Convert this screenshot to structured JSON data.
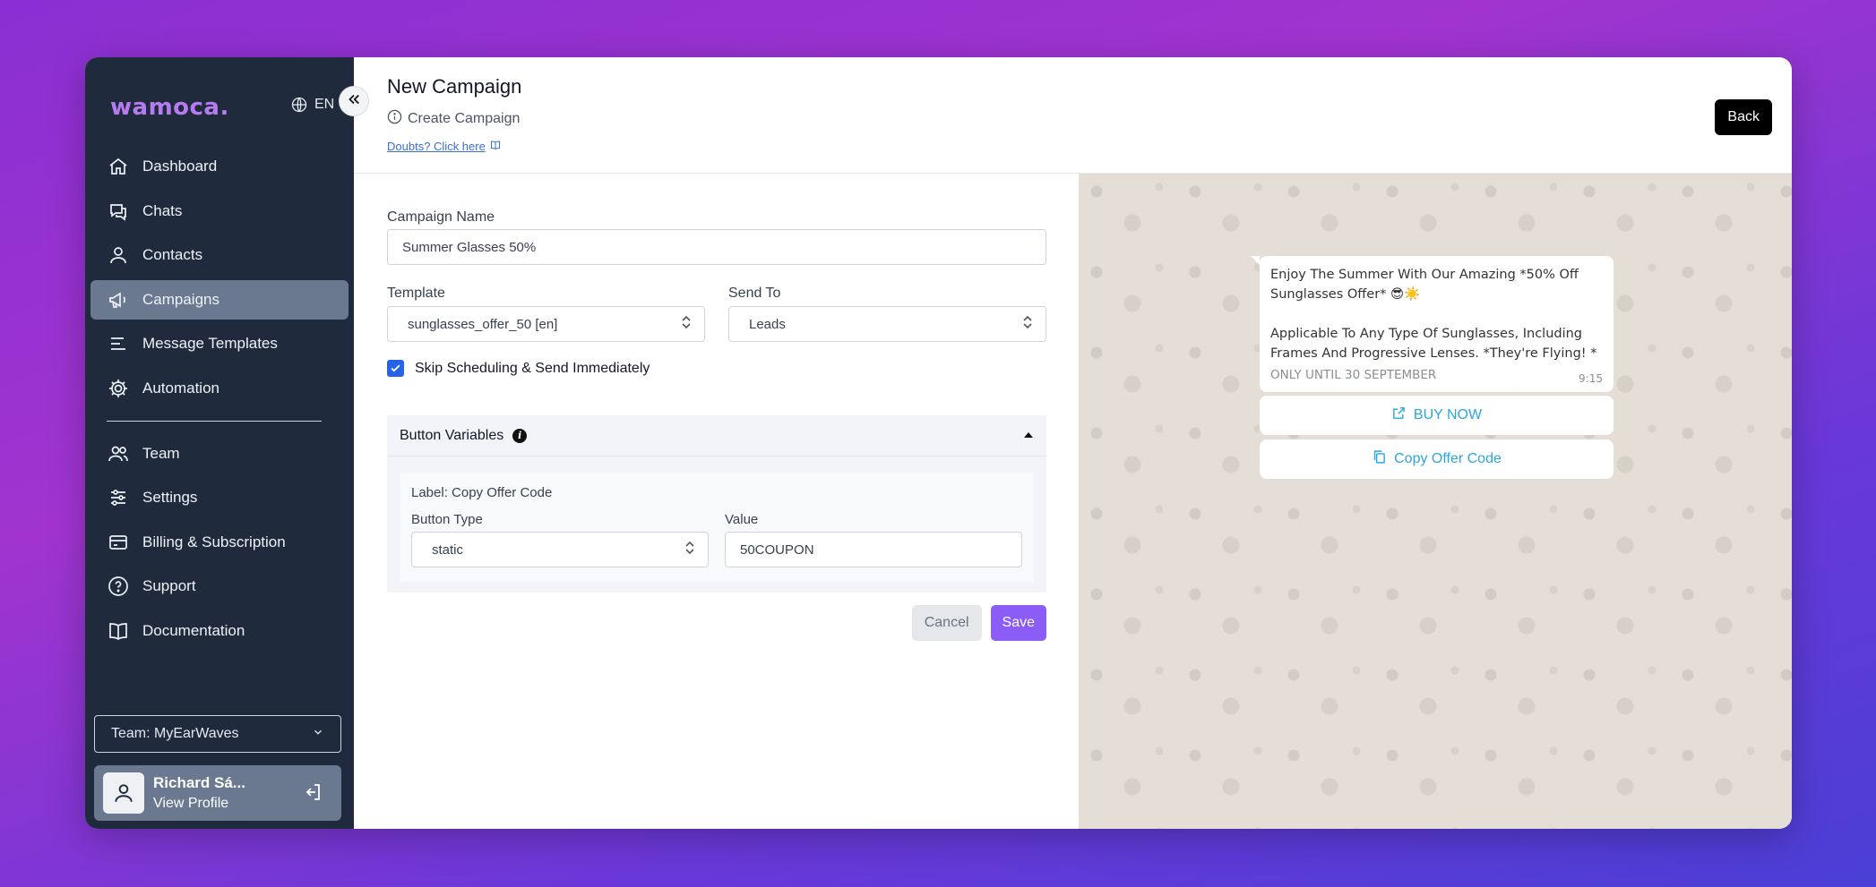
{
  "sidebar": {
    "logo": "wamoca.",
    "language": "EN",
    "items": [
      {
        "label": "Dashboard"
      },
      {
        "label": "Chats"
      },
      {
        "label": "Contacts"
      },
      {
        "label": "Campaigns"
      },
      {
        "label": "Message Templates"
      },
      {
        "label": "Automation"
      },
      {
        "label": "Team"
      },
      {
        "label": "Settings"
      },
      {
        "label": "Billing & Subscription"
      },
      {
        "label": "Support"
      },
      {
        "label": "Documentation"
      }
    ],
    "active_item": "Campaigns",
    "team_select": "Team: MyEarWaves",
    "profile": {
      "name": "Richard Sá...",
      "link": "View Profile"
    }
  },
  "header": {
    "title": "New Campaign",
    "subtitle": "Create Campaign",
    "doubts_link": "Doubts? Click here",
    "back_label": "Back"
  },
  "form": {
    "campaign_name_label": "Campaign Name",
    "campaign_name_value": "Summer Glasses 50%",
    "template_label": "Template",
    "template_value": "sunglasses_offer_50 [en]",
    "send_to_label": "Send To",
    "send_to_value": "Leads",
    "skip_label": "Skip Scheduling & Send Immediately",
    "skip_checked": true,
    "button_variables": {
      "title": "Button Variables",
      "item_label": "Label: Copy Offer Code",
      "button_type_label": "Button Type",
      "button_type_value": "static",
      "value_label": "Value",
      "value_value": "50COUPON"
    },
    "cancel_label": "Cancel",
    "save_label": "Save"
  },
  "preview": {
    "message": "Enjoy The Summer With Our Amazing *50% Off Sunglasses Offer* 😎☀️\n\nApplicable To Any Type Of Sunglasses, Including Frames And Progressive Lenses. *They're Flying! *",
    "footer": "ONLY UNTIL 30 SEPTEMBER",
    "time": "9:15",
    "buttons": [
      {
        "label": "BUY NOW",
        "icon": "external-link-icon"
      },
      {
        "label": "Copy Offer Code",
        "icon": "copy-icon"
      }
    ]
  },
  "colors": {
    "sidebar_bg": "#1f2a3c",
    "active_item_bg": "#6a7890",
    "logo": "#b57cf0",
    "save_button": "#8b5cf6",
    "link": "#2aa6e0"
  }
}
